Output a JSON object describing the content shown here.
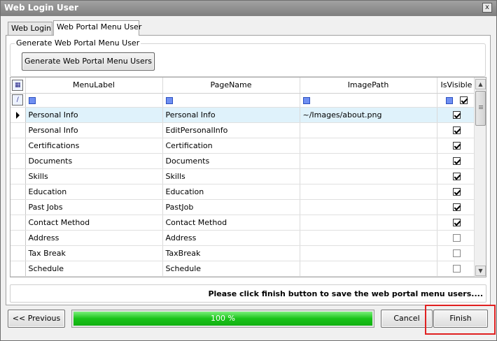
{
  "window": {
    "title": "Web Login User",
    "close_glyph": "x"
  },
  "tabs": [
    {
      "label": "Web Login"
    },
    {
      "label": "Web Portal Menu User"
    }
  ],
  "group": {
    "legend": "Generate Web Portal Menu User",
    "generate_button": "Generate Web Portal Menu Users"
  },
  "grid": {
    "columns": [
      "MenuLabel",
      "PageName",
      "ImagePath",
      "IsVisible"
    ],
    "rows": [
      {
        "menu_label": "Personal Info",
        "page_name": "Personal Info",
        "image_path": "~/Images/about.png",
        "is_visible": true
      },
      {
        "menu_label": "Personal Info",
        "page_name": "EditPersonalInfo",
        "image_path": "",
        "is_visible": true
      },
      {
        "menu_label": "Certifications",
        "page_name": "Certification",
        "image_path": "",
        "is_visible": true
      },
      {
        "menu_label": "Documents",
        "page_name": "Documents",
        "image_path": "",
        "is_visible": true
      },
      {
        "menu_label": "Skills",
        "page_name": "Skills",
        "image_path": "",
        "is_visible": true
      },
      {
        "menu_label": "Education",
        "page_name": "Education",
        "image_path": "",
        "is_visible": true
      },
      {
        "menu_label": "Past Jobs",
        "page_name": "PastJob",
        "image_path": "",
        "is_visible": true
      },
      {
        "menu_label": "Contact Method",
        "page_name": "Contact Method",
        "image_path": "",
        "is_visible": true
      },
      {
        "menu_label": "Address",
        "page_name": "Address",
        "image_path": "",
        "is_visible": false
      },
      {
        "menu_label": "Tax Break",
        "page_name": "TaxBreak",
        "image_path": "",
        "is_visible": false
      },
      {
        "menu_label": "Schedule",
        "page_name": "Schedule",
        "image_path": "",
        "is_visible": false
      }
    ],
    "selected_row": 0
  },
  "status": {
    "message": "Please click finish button to save the web portal menu users...."
  },
  "footer": {
    "previous_button": "<< Previous",
    "progress_label": "100 %",
    "progress_fraction": 1.0,
    "cancel_button": "Cancel",
    "finish_button": "Finish"
  },
  "colors": {
    "progress_green": "#19c319",
    "highlight_red": "#e02020",
    "selected_row": "#dff2fb"
  }
}
